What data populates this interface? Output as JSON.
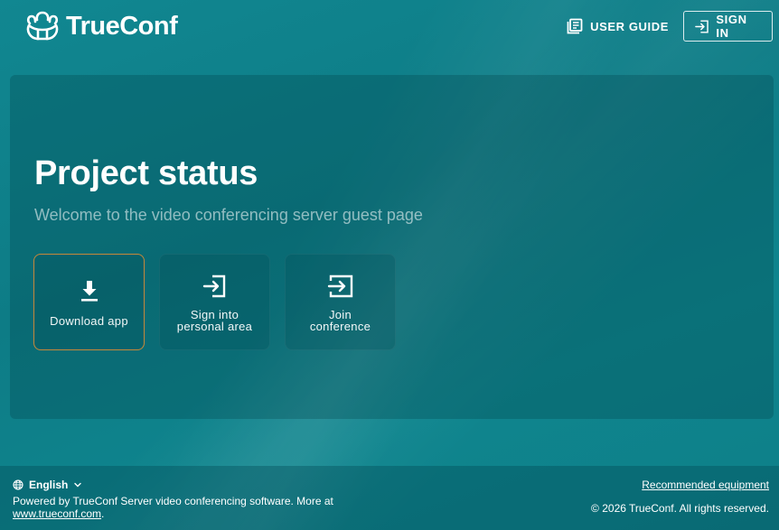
{
  "header": {
    "logo_text": "TrueConf",
    "user_guide_label": "USER GUIDE",
    "sign_in_label": "SIGN IN"
  },
  "main": {
    "title": "Project status",
    "subtitle": "Welcome to the video conferencing server guest page",
    "cards": [
      {
        "label": "Download app",
        "icon": "download-icon"
      },
      {
        "label_line1": "Sign into",
        "label_line2": "personal area",
        "icon": "sign-in-icon"
      },
      {
        "label_line1": "Join",
        "label_line2": "conference",
        "icon": "join-conference-icon"
      }
    ]
  },
  "footer": {
    "language": "English",
    "powered_text": "Powered by TrueConf Server video conferencing software. More at",
    "powered_link": "www.trueconf.com",
    "powered_suffix": ".",
    "recommended": "Recommended equipment",
    "copyright": "© 2026 TrueConf. All rights reserved."
  },
  "colors": {
    "background": "#0e7f89",
    "active_card_border": "#c6883a",
    "text": "#ffffff"
  }
}
